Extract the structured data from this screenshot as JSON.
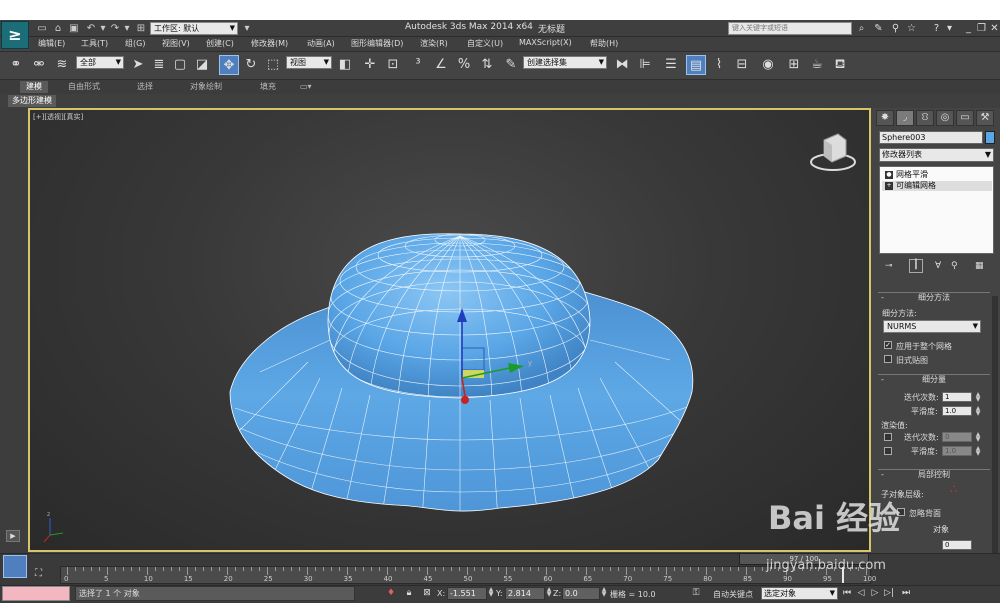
{
  "titlebar": {
    "app_title": "Autodesk 3ds Max  2014 x64",
    "doc_title": "无标题",
    "workspace_label": "工作区: 默认",
    "search_placeholder": "键入关键字或短语",
    "app_icon": "3ds-max-logo"
  },
  "menu": [
    "编辑(E)",
    "工具(T)",
    "组(G)",
    "视图(V)",
    "创建(C)",
    "修改器(M)",
    "动画(A)",
    "图形编辑器(D)",
    "渲染(R)",
    "自定义(U)",
    "MAXScript(X)",
    "帮助(H)"
  ],
  "toolbar": {
    "selection_filter": "全部",
    "ref_coord": "视图",
    "named_selection": "创建选择集"
  },
  "ribbon": {
    "tabs": [
      "建模",
      "自由形式",
      "选择",
      "对象绘制",
      "填充"
    ],
    "active_tab": "建模",
    "panel_label": "多边形建模"
  },
  "viewport": {
    "label": "[+][透视][真实]",
    "active_border_color": "#d8c46a",
    "object_color": "#5aa6e6"
  },
  "command_panel": {
    "object_name": "Sphere003",
    "modifier_list": "修改器列表",
    "stack": [
      "网格平滑",
      "可编辑网格"
    ],
    "subdivision_method": {
      "title": "细分方法",
      "method_label": "细分方法:",
      "method_value": "NURMS",
      "apply_whole": "应用于整个网格",
      "apply_whole_checked": true,
      "old_mapping": "旧式贴图"
    },
    "subdivision_amount": {
      "title": "细分量",
      "iterations_label": "迭代次数:",
      "iterations": "1",
      "smoothness_label": "平滑度:",
      "smoothness": "1.0",
      "render_values": "渲染值:",
      "render_iterations": "0",
      "render_smoothness": "1.0"
    },
    "local_control": {
      "title": "局部控制",
      "sub_object_level": "子对象层级:",
      "ignore_backfacing": "忽略背面",
      "object": "对象"
    }
  },
  "timeline": {
    "slider": "97 / 100",
    "current_frame": 97,
    "total_frames": 100,
    "ticks": [
      "0",
      "5",
      "10",
      "15",
      "20",
      "25",
      "30",
      "35",
      "40",
      "45",
      "50",
      "55",
      "60",
      "65",
      "70",
      "75",
      "80",
      "85",
      "90",
      "95",
      "100"
    ]
  },
  "statusbar": {
    "status_text": "选择了 1 个 对象",
    "x_label": "X:",
    "x": "-1.551",
    "y_label": "Y:",
    "y": "2.814",
    "z_label": "Z:",
    "z": "0.0",
    "grid": "栅格 = 10.0",
    "auto_key": "自动关键点",
    "selected_set": "选定对象"
  },
  "watermark": {
    "line1": "Bai  经验",
    "line2": "jingyan.baidu.com"
  }
}
